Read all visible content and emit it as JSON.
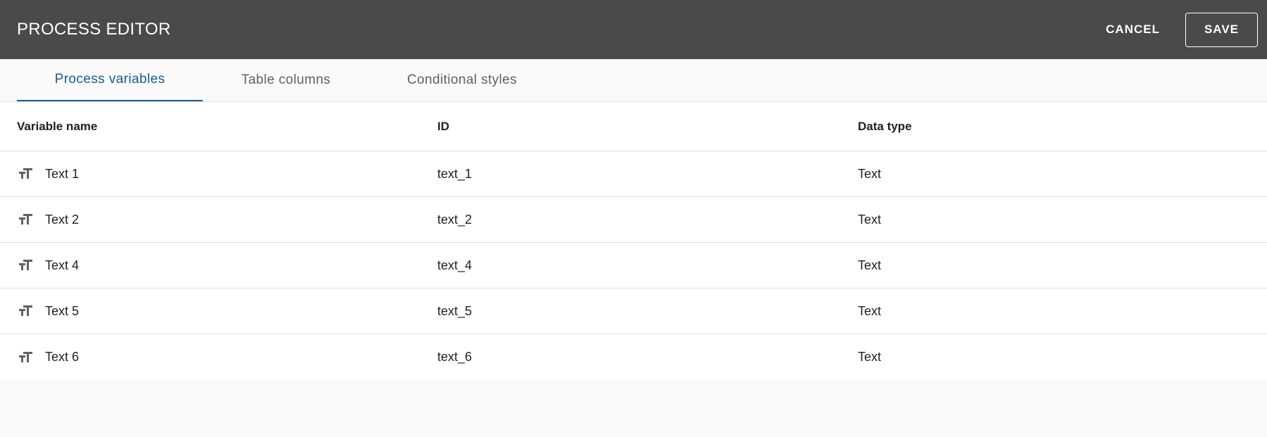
{
  "header": {
    "title": "PROCESS EDITOR",
    "cancel_label": "CANCEL",
    "save_label": "SAVE"
  },
  "tabs": [
    {
      "label": "Process variables",
      "active": true
    },
    {
      "label": "Table columns",
      "active": false
    },
    {
      "label": "Conditional styles",
      "active": false
    }
  ],
  "table": {
    "columns": [
      "Variable name",
      "ID",
      "Data type"
    ],
    "rows": [
      {
        "icon": "text-type-icon",
        "name": "Text 1",
        "id": "text_1",
        "type": "Text"
      },
      {
        "icon": "text-type-icon",
        "name": "Text 2",
        "id": "text_2",
        "type": "Text"
      },
      {
        "icon": "text-type-icon",
        "name": "Text 4",
        "id": "text_4",
        "type": "Text"
      },
      {
        "icon": "text-type-icon",
        "name": "Text 5",
        "id": "text_5",
        "type": "Text"
      },
      {
        "icon": "text-type-icon",
        "name": "Text 6",
        "id": "text_6",
        "type": "Text"
      }
    ]
  },
  "colors": {
    "header_bg": "#4a4a4a",
    "active_tab": "#1a5b8c",
    "icon": "#616161"
  }
}
